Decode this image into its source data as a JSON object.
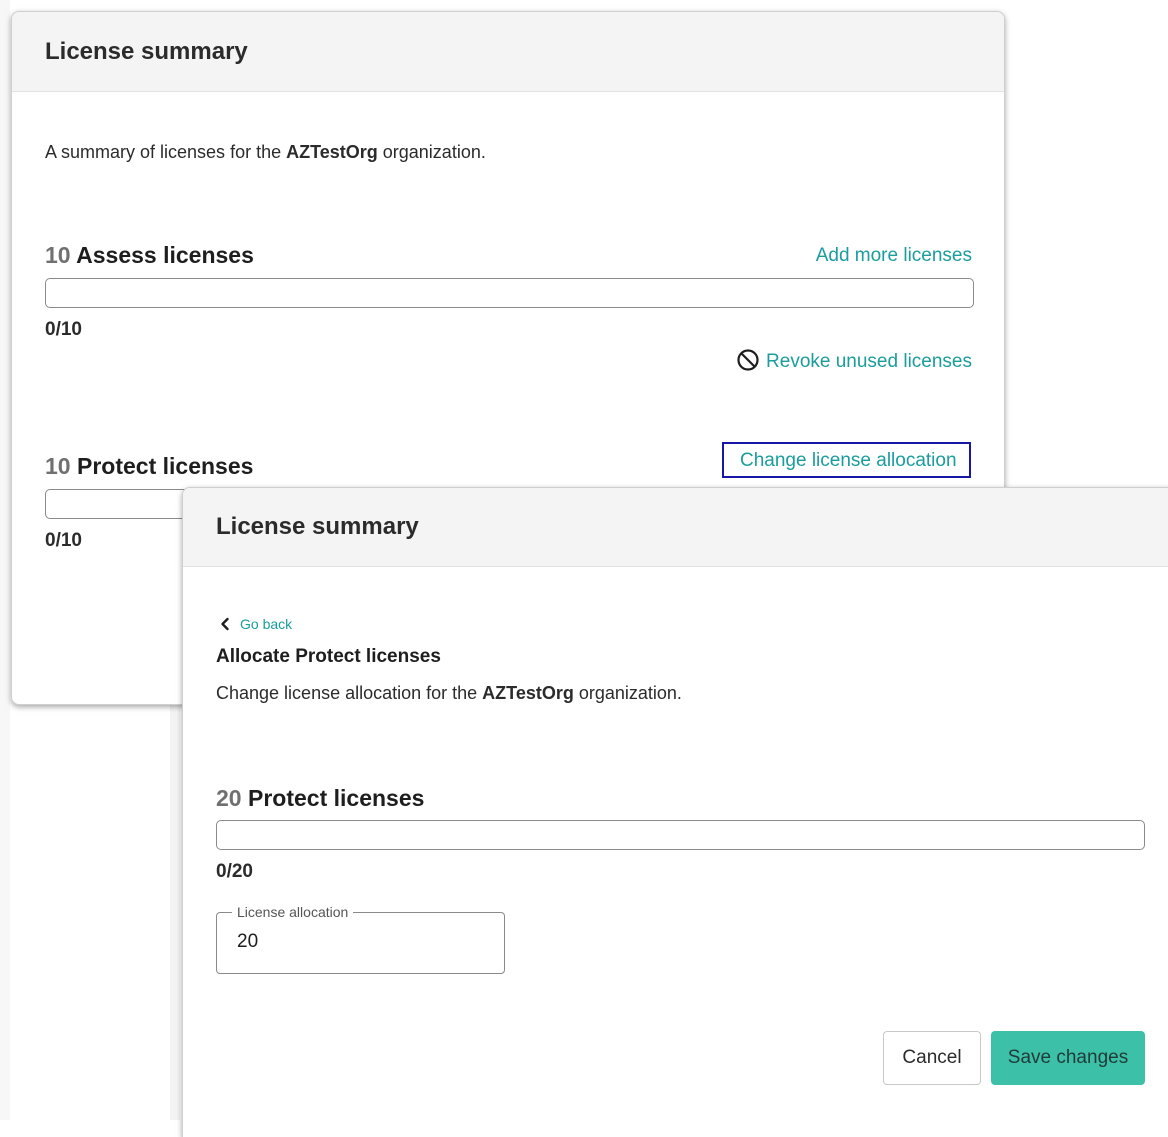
{
  "colors": {
    "accent_link": "#1a9d9c",
    "focus_outline": "#1616a8",
    "save_button": "#3cc0a8",
    "header_bg": "#f4f4f4"
  },
  "modal1": {
    "title": "License summary",
    "desc_prefix": "A summary of licenses for the ",
    "org_name": "AZTestOrg",
    "desc_suffix": " organization.",
    "assess": {
      "count": "10",
      "label": "Assess licenses",
      "usage": "0/10",
      "used_fraction": 0,
      "add_link": "Add more licenses",
      "revoke_link": "Revoke unused licenses",
      "revoke_icon": "ban-icon"
    },
    "protect": {
      "count": "10",
      "label": "Protect licenses",
      "usage": "0/10",
      "used_fraction": 0,
      "change_link": "Change license allocation"
    }
  },
  "modal2": {
    "title": "License summary",
    "back_label": "Go back",
    "back_icon": "chevron-left-icon",
    "subheading": "Allocate Protect licenses",
    "desc_prefix": "Change license allocation for the ",
    "org_name": "AZTestOrg",
    "desc_suffix": " organization.",
    "protect": {
      "count": "20",
      "label": "Protect licenses",
      "usage": "0/20",
      "used_fraction": 0
    },
    "allocation_field": {
      "legend": "License allocation",
      "value": "20"
    },
    "cancel_label": "Cancel",
    "save_label": "Save changes"
  }
}
